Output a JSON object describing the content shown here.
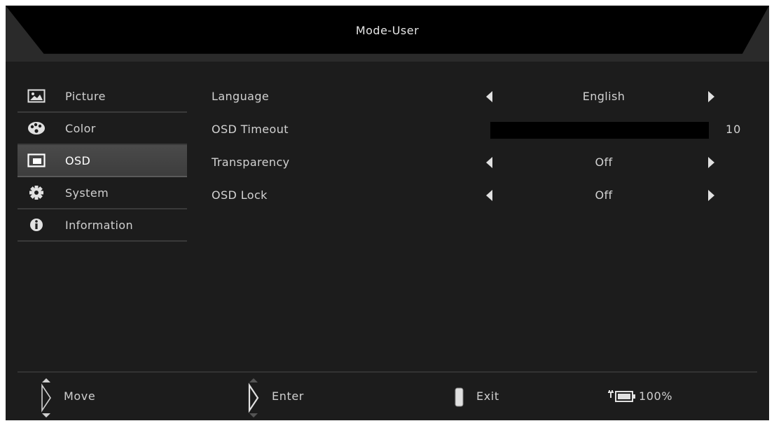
{
  "header": {
    "title": "Mode-User"
  },
  "sidebar": {
    "items": [
      {
        "label": "Picture",
        "icon": "picture-icon",
        "active": false
      },
      {
        "label": "Color",
        "icon": "palette-icon",
        "active": false
      },
      {
        "label": "OSD",
        "icon": "osd-icon",
        "active": true
      },
      {
        "label": "System",
        "icon": "gear-icon",
        "active": false
      },
      {
        "label": "Information",
        "icon": "info-icon",
        "active": false
      }
    ]
  },
  "settings": {
    "language": {
      "label": "Language",
      "value": "English"
    },
    "osd_timeout": {
      "label": "OSD Timeout",
      "value": "10"
    },
    "transparency": {
      "label": "Transparency",
      "value": "Off"
    },
    "osd_lock": {
      "label": "OSD Lock",
      "value": "Off"
    }
  },
  "footer": {
    "move": "Move",
    "enter": "Enter",
    "exit": "Exit",
    "power": "100%"
  },
  "colors": {
    "background": "#1c1c1c",
    "header_band": "#000000",
    "active_item": "#444444",
    "text": "#d2d2d2"
  }
}
